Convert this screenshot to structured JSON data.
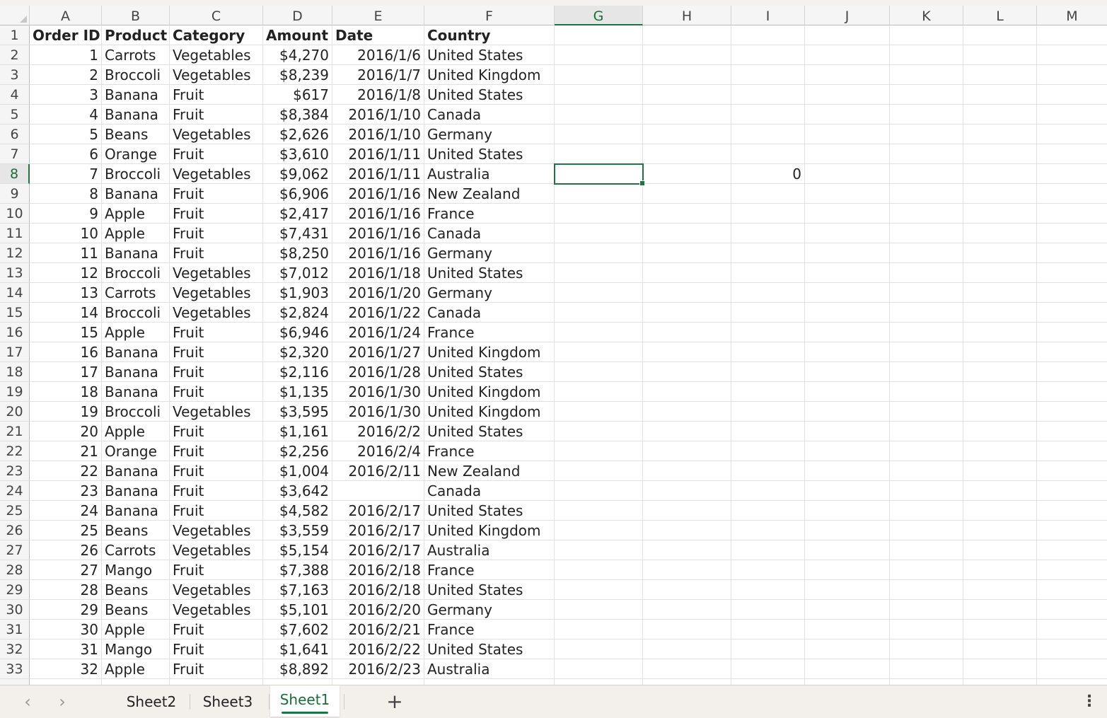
{
  "columns": [
    "A",
    "B",
    "C",
    "D",
    "E",
    "F",
    "G",
    "H",
    "I",
    "J",
    "K",
    "L",
    "M"
  ],
  "active_column": "G",
  "active_row": 8,
  "name_cell": "G8",
  "header_row": [
    "Order ID",
    "Product",
    "Category",
    "Amount",
    "Date",
    "Country"
  ],
  "rows": [
    [
      "1",
      "Carrots",
      "Vegetables",
      "$4,270",
      "2016/1/6",
      "United States"
    ],
    [
      "2",
      "Broccoli",
      "Vegetables",
      "$8,239",
      "2016/1/7",
      "United Kingdom"
    ],
    [
      "3",
      "Banana",
      "Fruit",
      "$617",
      "2016/1/8",
      "United States"
    ],
    [
      "4",
      "Banana",
      "Fruit",
      "$8,384",
      "2016/1/10",
      "Canada"
    ],
    [
      "5",
      "Beans",
      "Vegetables",
      "$2,626",
      "2016/1/10",
      "Germany"
    ],
    [
      "6",
      "Orange",
      "Fruit",
      "$3,610",
      "2016/1/11",
      "United States"
    ],
    [
      "7",
      "Broccoli",
      "Vegetables",
      "$9,062",
      "2016/1/11",
      "Australia"
    ],
    [
      "8",
      "Banana",
      "Fruit",
      "$6,906",
      "2016/1/16",
      "New Zealand"
    ],
    [
      "9",
      "Apple",
      "Fruit",
      "$2,417",
      "2016/1/16",
      "France"
    ],
    [
      "10",
      "Apple",
      "Fruit",
      "$7,431",
      "2016/1/16",
      "Canada"
    ],
    [
      "11",
      "Banana",
      "Fruit",
      "$8,250",
      "2016/1/16",
      "Germany"
    ],
    [
      "12",
      "Broccoli",
      "Vegetables",
      "$7,012",
      "2016/1/18",
      "United States"
    ],
    [
      "13",
      "Carrots",
      "Vegetables",
      "$1,903",
      "2016/1/20",
      "Germany"
    ],
    [
      "14",
      "Broccoli",
      "Vegetables",
      "$2,824",
      "2016/1/22",
      "Canada"
    ],
    [
      "15",
      "Apple",
      "Fruit",
      "$6,946",
      "2016/1/24",
      "France"
    ],
    [
      "16",
      "Banana",
      "Fruit",
      "$2,320",
      "2016/1/27",
      "United Kingdom"
    ],
    [
      "17",
      "Banana",
      "Fruit",
      "$2,116",
      "2016/1/28",
      "United States"
    ],
    [
      "18",
      "Banana",
      "Fruit",
      "$1,135",
      "2016/1/30",
      "United Kingdom"
    ],
    [
      "19",
      "Broccoli",
      "Vegetables",
      "$3,595",
      "2016/1/30",
      "United Kingdom"
    ],
    [
      "20",
      "Apple",
      "Fruit",
      "$1,161",
      "2016/2/2",
      "United States"
    ],
    [
      "21",
      "Orange",
      "Fruit",
      "$2,256",
      "2016/2/4",
      "France"
    ],
    [
      "22",
      "Banana",
      "Fruit",
      "$1,004",
      "2016/2/11",
      "New Zealand"
    ],
    [
      "23",
      "Banana",
      "Fruit",
      "$3,642",
      "",
      "Canada"
    ],
    [
      "24",
      "Banana",
      "Fruit",
      "$4,582",
      "2016/2/17",
      "United States"
    ],
    [
      "25",
      "Beans",
      "Vegetables",
      "$3,559",
      "2016/2/17",
      "United Kingdom"
    ],
    [
      "26",
      "Carrots",
      "Vegetables",
      "$5,154",
      "2016/2/17",
      "Australia"
    ],
    [
      "27",
      "Mango",
      "Fruit",
      "$7,388",
      "2016/2/18",
      "France"
    ],
    [
      "28",
      "Beans",
      "Vegetables",
      "$7,163",
      "2016/2/18",
      "United States"
    ],
    [
      "29",
      "Beans",
      "Vegetables",
      "$5,101",
      "2016/2/20",
      "Germany"
    ],
    [
      "30",
      "Apple",
      "Fruit",
      "$7,602",
      "2016/2/21",
      "France"
    ],
    [
      "31",
      "Mango",
      "Fruit",
      "$1,641",
      "2016/2/22",
      "United States"
    ],
    [
      "32",
      "Apple",
      "Fruit",
      "$8,892",
      "2016/2/23",
      "Australia"
    ]
  ],
  "extra_cells": [
    {
      "row": 8,
      "col": "I",
      "value": "0"
    }
  ],
  "tabbar": {
    "prev_icon": "chevron-left-icon",
    "next_icon": "chevron-right-icon",
    "tabs": [
      "Sheet2",
      "Sheet3",
      "Sheet1"
    ],
    "active_tab": "Sheet1",
    "add_icon": "plus-icon",
    "more_icon": "more-vertical-icon"
  },
  "colors": {
    "accent": "#217346",
    "header_bg": "#f5f5f5",
    "gridline": "#e1e1e1"
  }
}
